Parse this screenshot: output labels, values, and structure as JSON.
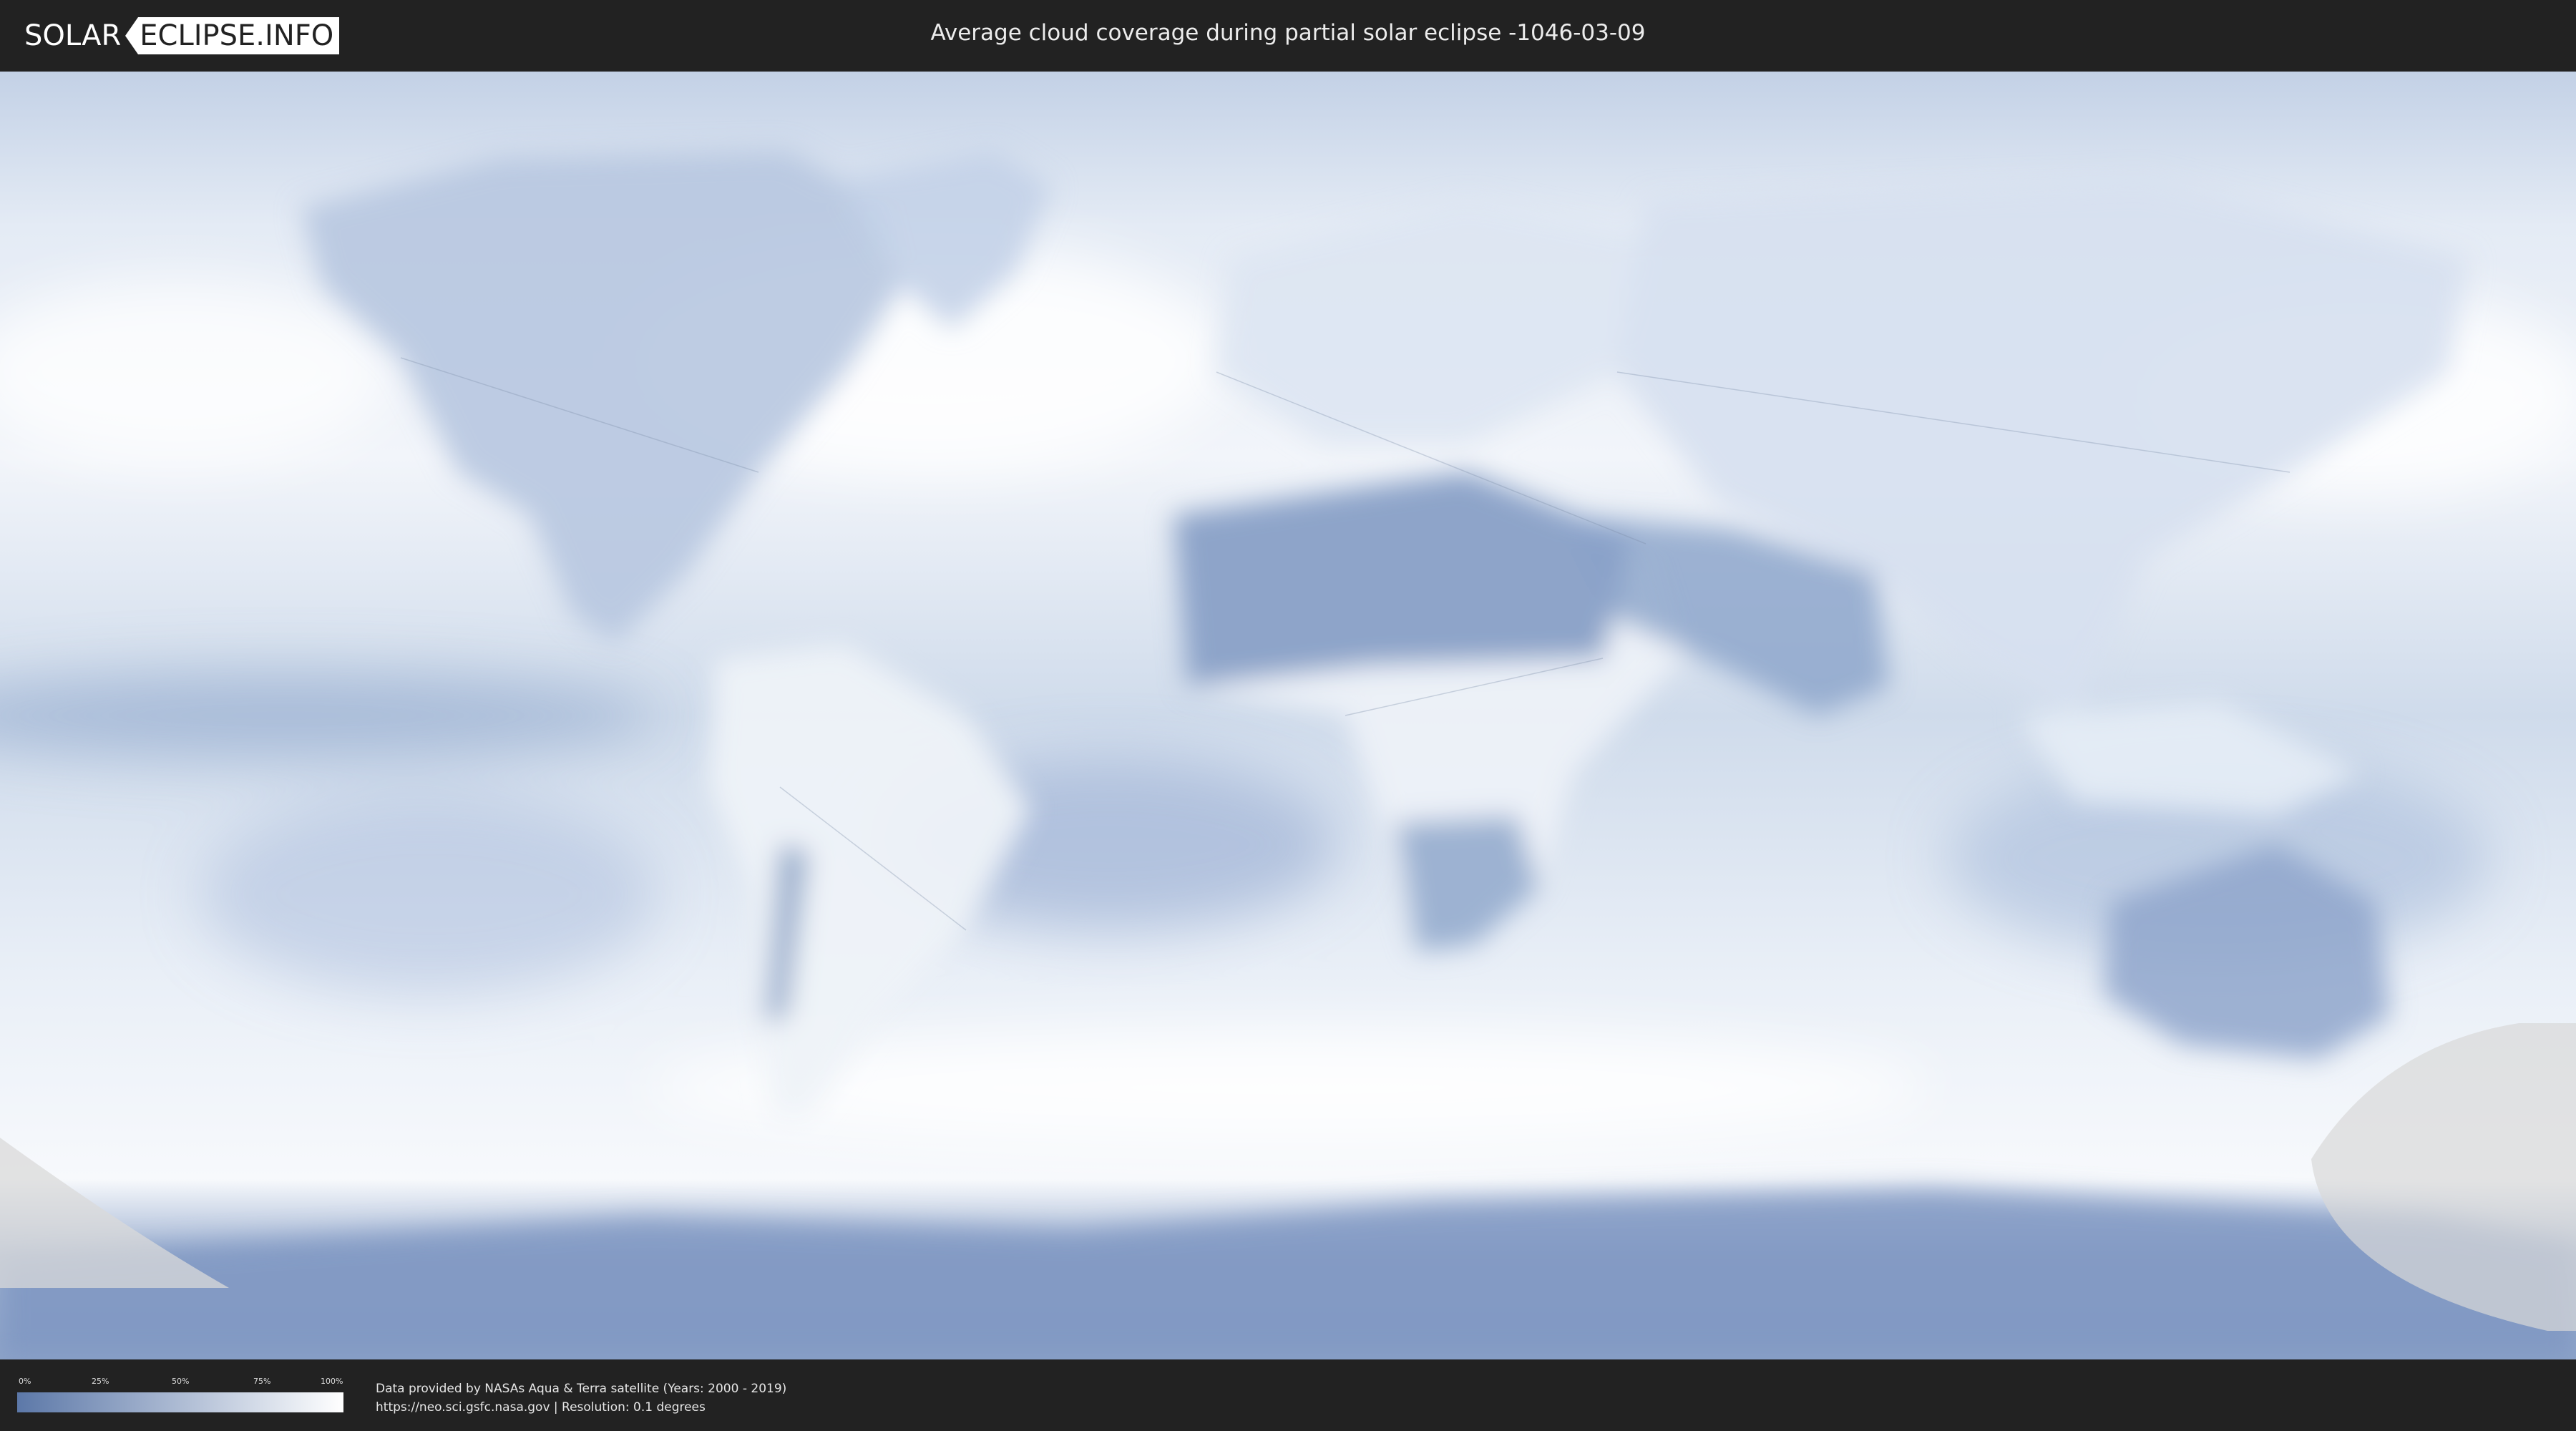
{
  "header": {
    "logo_left": "SOLAR",
    "logo_right": "ECLIPSE.INFO",
    "title": "Average cloud coverage during partial solar eclipse -1046-03-09"
  },
  "legend": {
    "ticks": [
      "0%",
      "25%",
      "50%",
      "75%",
      "100%"
    ],
    "color_low": "#5c78a8",
    "color_high": "#ffffff"
  },
  "footer": {
    "credit_line1": "Data provided by NASAs Aqua & Terra satellite (Years: 2000 - 2019)",
    "credit_line2": "https://neo.sci.gsfc.nasa.gov | Resolution: 0.1 degrees"
  },
  "map": {
    "ocean_color": "#dfe8f3",
    "cloud_clear_color": "#6f8bb8",
    "eclipse_shadow_color": "#d9d9d9"
  }
}
